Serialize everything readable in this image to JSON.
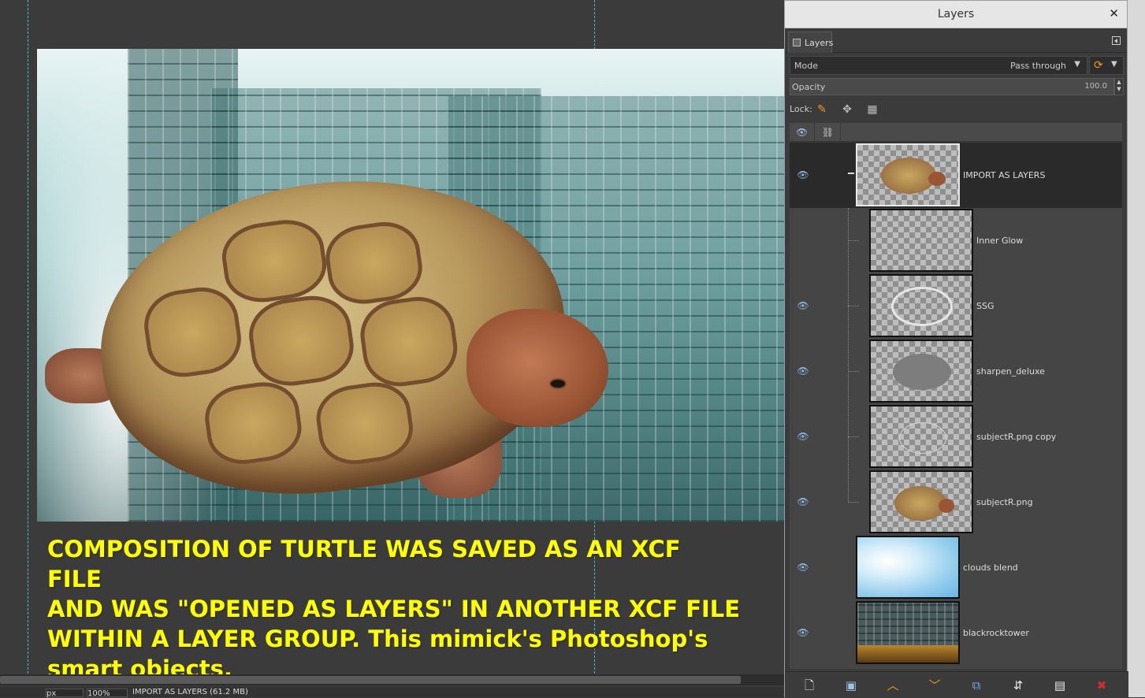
{
  "canvas": {
    "caption": "COMPOSITION OF TURTLE WAS SAVED AS AN XCF FILE\nAND WAS \"OPENED AS LAYERS\" IN ANOTHER XCF FILE\nWITHIN A LAYER GROUP. This mimick's Photoshop's\nsmart objects."
  },
  "statusbar": {
    "unit": "px",
    "zoom": "100%",
    "status_text": "IMPORT AS LAYERS (61.2 MB)"
  },
  "layers_dialog": {
    "title": "Layers",
    "tab_label": "Layers",
    "mode_label": "Mode",
    "mode_value": "Pass through",
    "opacity_label": "Opacity",
    "opacity_value": "100.0",
    "lock_label": "Lock:",
    "layers": [
      {
        "name": "IMPORT AS LAYERS",
        "visible": true,
        "selected": true,
        "group": true,
        "indent": 0,
        "thumb": "turtle"
      },
      {
        "name": "Inner Glow",
        "visible": false,
        "indent": 1,
        "thumb": "empty"
      },
      {
        "name": "SSG",
        "visible": true,
        "indent": 1,
        "thumb": "outline"
      },
      {
        "name": "sharpen_deluxe",
        "visible": true,
        "indent": 1,
        "thumb": "gray-turtle"
      },
      {
        "name": "subjectR.png copy",
        "visible": true,
        "indent": 1,
        "thumb": "faint-outline"
      },
      {
        "name": "subjectR.png",
        "visible": true,
        "indent": 1,
        "thumb": "turtle"
      },
      {
        "name": "clouds blend",
        "visible": true,
        "indent": 0,
        "thumb": "clouds"
      },
      {
        "name": "blackrocktower",
        "visible": true,
        "indent": 0,
        "thumb": "building"
      }
    ],
    "bottom_buttons": [
      "new-layer-icon",
      "new-group-icon",
      "raise-layer-icon",
      "lower-layer-icon",
      "duplicate-layer-icon",
      "merge-down-icon",
      "mask-icon",
      "delete-layer-icon"
    ]
  },
  "colors": {
    "caption": "#ffff00",
    "guide": "#3cc7c2",
    "eye": "#8fbde8",
    "accent_orange": "#f39a1c",
    "delete_red": "#d62c2c"
  }
}
